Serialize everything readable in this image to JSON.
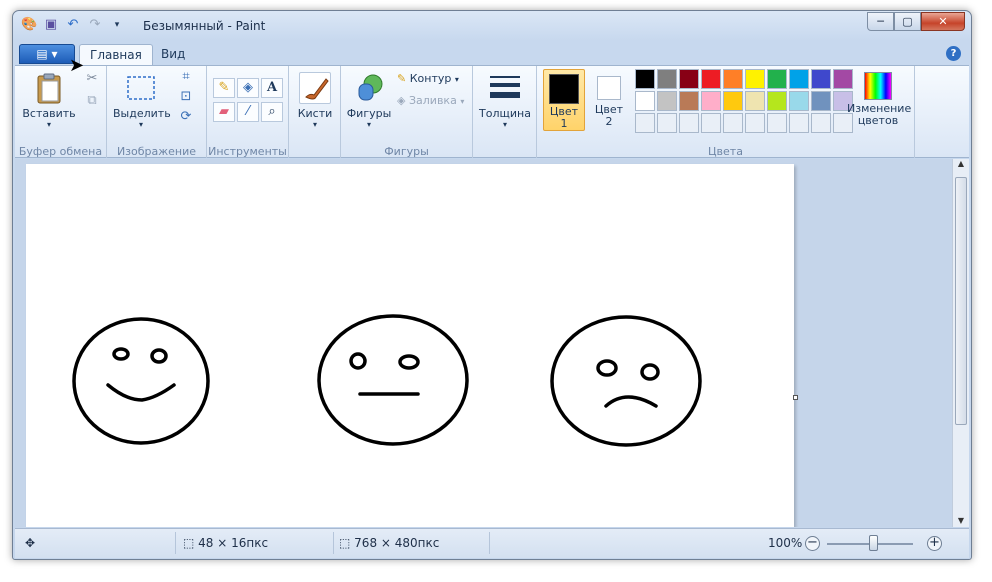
{
  "window": {
    "title": "Безымянный - Paint"
  },
  "title_buttons": {
    "minimize": "─",
    "maximize": "▢",
    "close": "✕"
  },
  "tabs": [
    {
      "label": "Главная"
    },
    {
      "label": "Вид"
    }
  ],
  "help": "?",
  "ribbon": {
    "clipboard": {
      "group": "Буфер обмена",
      "paste": "Вставить"
    },
    "image": {
      "group": "Изображение",
      "select": "Выделить"
    },
    "tools": {
      "group": "Инструменты"
    },
    "brushes": {
      "label": "Кисти"
    },
    "shapes": {
      "group": "Фигуры",
      "shapes": "Фигуры",
      "outline": "Контур",
      "fill": "Заливка"
    },
    "size": {
      "label": "Толщина"
    },
    "colors": {
      "group": "Цвета",
      "color1": "Цвет 1",
      "color2": "Цвет 2",
      "edit": "Изменение цветов",
      "color1_value": "#000000",
      "color2_value": "#ffffff",
      "palette_row1": [
        "#000000",
        "#7f7f7f",
        "#880015",
        "#ed1c24",
        "#ff7f27",
        "#fff200",
        "#22b14c",
        "#00a2e8",
        "#3f48cc",
        "#a349a4"
      ],
      "palette_row2": [
        "#ffffff",
        "#c3c3c3",
        "#b97a57",
        "#ffaec9",
        "#ffc90e",
        "#efe4b0",
        "#b5e61d",
        "#99d9ea",
        "#7092be",
        "#c8bfe7"
      ]
    }
  },
  "status": {
    "selection_size": "48 × 16пкс",
    "image_size": "768 × 480пкс",
    "zoom": "100%",
    "zoom_level_percent": 100
  },
  "canvas_faces": [
    "smile",
    "neutral",
    "sad"
  ]
}
